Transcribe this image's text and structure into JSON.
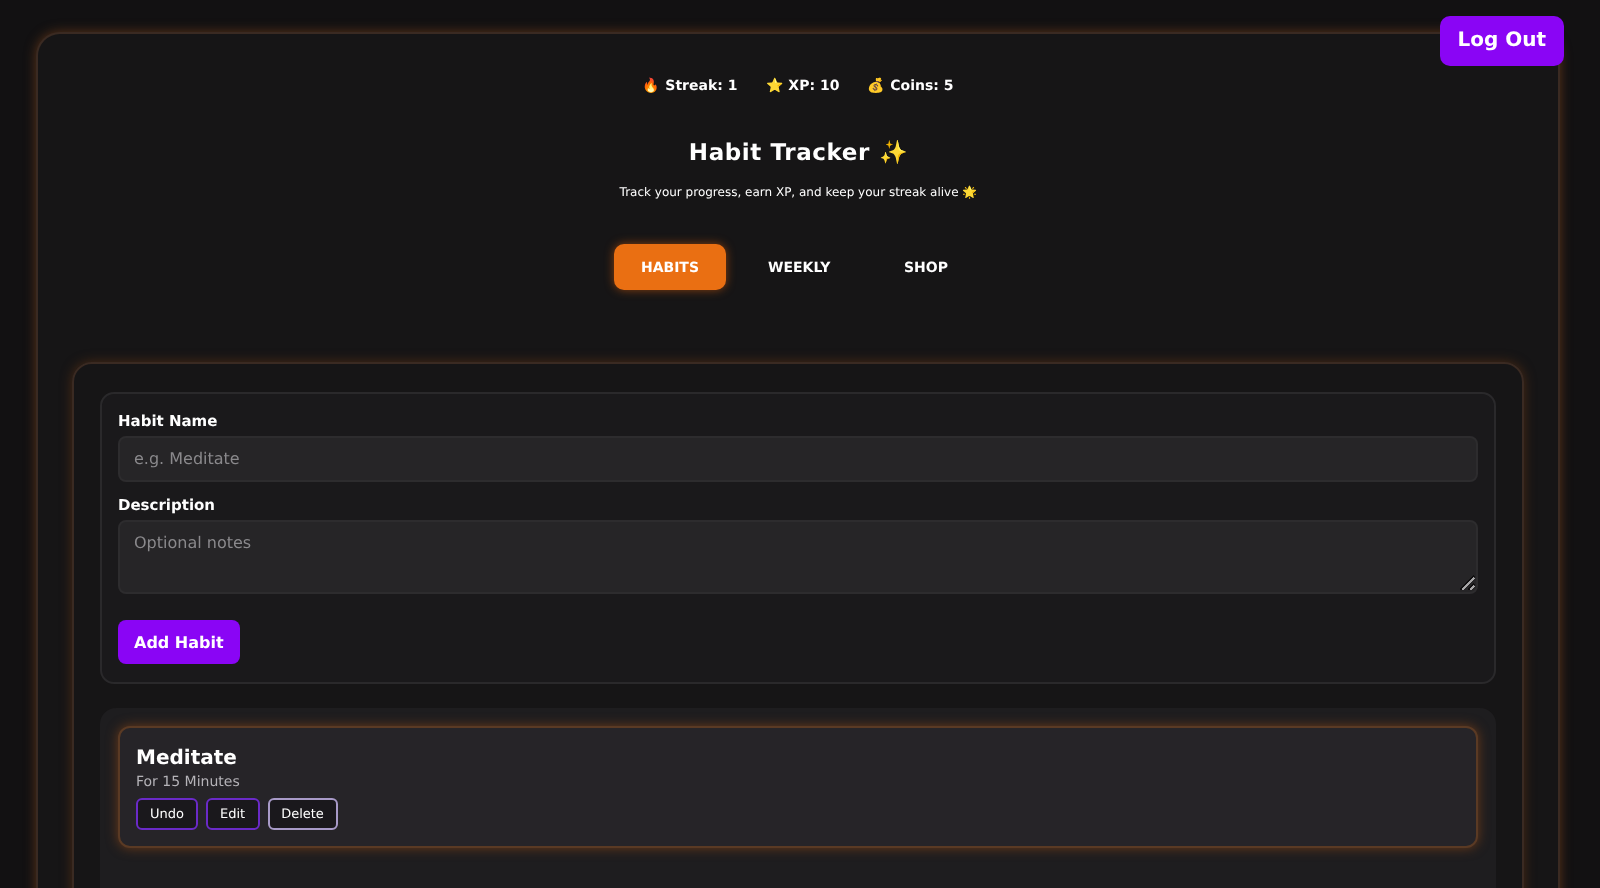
{
  "logout_button": "Log Out",
  "stats": [
    {
      "icon": "🔥",
      "label": "Streak: 1"
    },
    {
      "icon": "⭐",
      "label": "XP: 10"
    },
    {
      "icon": "💰",
      "label": "Coins: 5"
    }
  ],
  "title": "Habit Tracker ✨",
  "subtitle": "Track your progress, earn XP, and keep your streak alive 🌟",
  "tabs": [
    {
      "label": "HABITS",
      "selected": true
    },
    {
      "label": "WEEKLY",
      "selected": false
    },
    {
      "label": "SHOP",
      "selected": false
    }
  ],
  "form": {
    "name_label": "Habit Name",
    "name_placeholder": "e.g. Meditate",
    "description_label": "Description",
    "description_placeholder": "Optional notes",
    "submit": "Add Habit"
  },
  "habits": [
    {
      "name": "Meditate",
      "description": "For 15 Minutes",
      "actions": [
        "Undo",
        "Edit",
        "Delete"
      ]
    }
  ]
}
